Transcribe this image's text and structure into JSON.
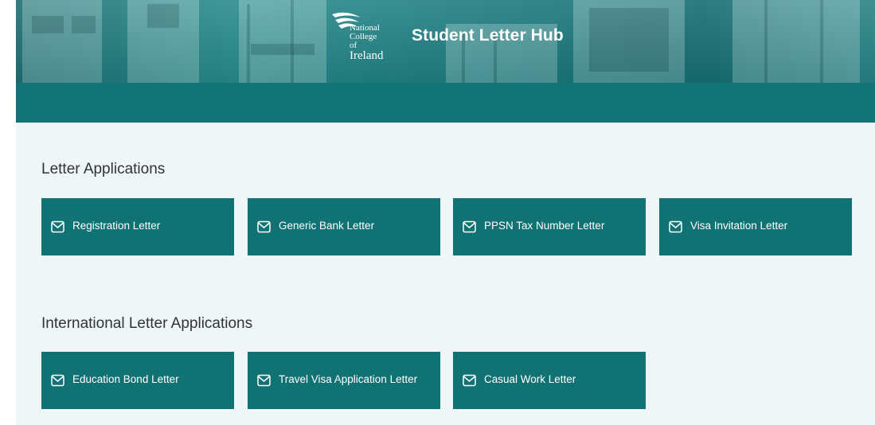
{
  "header": {
    "logo_lines": [
      "National",
      "College of",
      "Ireland"
    ],
    "title": "Student Letter Hub"
  },
  "sections": [
    {
      "title": "Letter Applications",
      "cards": [
        {
          "label": "Registration Letter",
          "icon": "envelope-icon"
        },
        {
          "label": "Generic Bank Letter",
          "icon": "envelope-icon"
        },
        {
          "label": "PPSN Tax Number Letter",
          "icon": "envelope-icon"
        },
        {
          "label": "Visa Invitation Letter",
          "icon": "envelope-icon"
        }
      ]
    },
    {
      "title": "International Letter Applications",
      "cards": [
        {
          "label": "Education Bond Letter",
          "icon": "envelope-icon"
        },
        {
          "label": "Travel Visa Application Letter",
          "icon": "envelope-icon"
        },
        {
          "label": "Casual Work Letter",
          "icon": "envelope-icon"
        }
      ]
    }
  ],
  "colors": {
    "card": "#117274",
    "nav_bar": "#127376",
    "page_bg": "#eef6f7"
  }
}
